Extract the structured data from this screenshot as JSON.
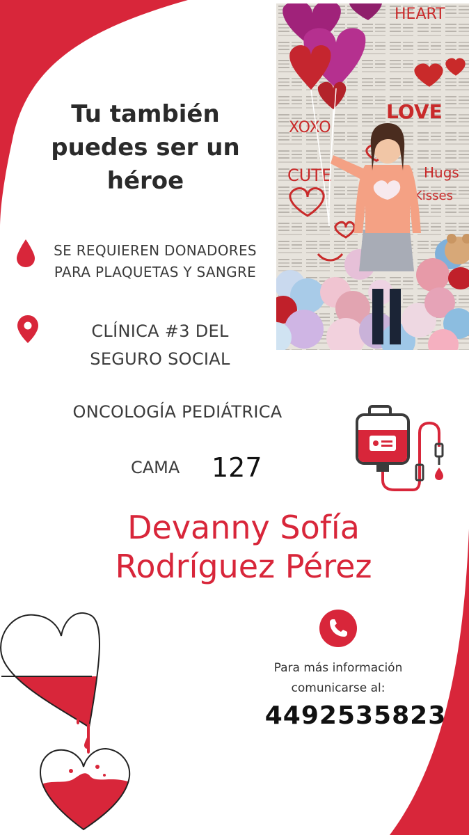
{
  "headline": [
    "Tu también",
    "puedes ser un",
    "héroe"
  ],
  "donors": {
    "icon": "blood-drop-icon",
    "lines": [
      "SE REQUIEREN DONADORES",
      "PARA PLAQUETAS Y SANGRE"
    ]
  },
  "clinic": {
    "icon": "location-pin-icon",
    "lines": [
      "CLÍNICA #3 DEL",
      "SEGURO SOCIAL"
    ]
  },
  "ward": "ONCOLOGÍA PEDIÁTRICA",
  "bed": {
    "label": "CAMA",
    "number": "127"
  },
  "patient_name": [
    "Devanny Sofía",
    "Rodríguez Pérez"
  ],
  "contact": {
    "icon": "phone-icon",
    "lines": [
      "Para más información",
      "comunicarse al:"
    ],
    "phone": "4492535823"
  },
  "photo": {
    "wall_words": [
      "HEART",
      "LOVE",
      "XOXO",
      "CUTE",
      "Hugs",
      "Kisses"
    ]
  },
  "colors": {
    "accent": "#d8263a",
    "text": "#2a2a2a"
  }
}
